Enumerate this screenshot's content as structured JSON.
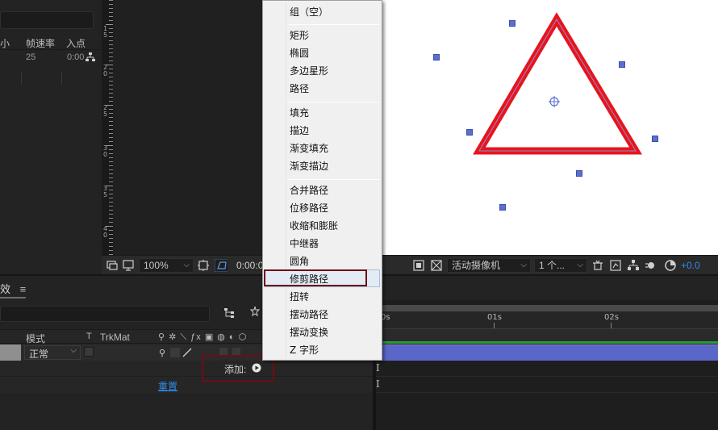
{
  "project_panel": {
    "columns": {
      "size": "小",
      "frame_rate": "帧速率",
      "in_point": "入点"
    },
    "row": {
      "frame_rate": "25",
      "in_point": "0:00"
    }
  },
  "ruler_labels": [
    "1",
    "5",
    "2",
    "0",
    "2",
    "5",
    "3",
    "0",
    "3",
    "5",
    "4",
    "0"
  ],
  "comp_toolbar": {
    "zoom": "100%",
    "timecode": "0:00:0",
    "camera": "活动摄像机",
    "views": "1 个...",
    "exposure": "+0.0"
  },
  "context_menu": {
    "items": [
      "组（空）",
      "矩形",
      "椭圆",
      "多边星形",
      "路径",
      "填充",
      "描边",
      "渐变填充",
      "渐变描边",
      "合并路径",
      "位移路径",
      "收缩和膨胀",
      "中继器",
      "圆角",
      "修剪路径",
      "扭转",
      "摆动路径",
      "摆动变换",
      "Z 字形"
    ],
    "hovered": "修剪路径"
  },
  "timeline": {
    "tab_label": "效",
    "tab_menu": "≡",
    "columns": {
      "mode": "模式",
      "t": "T",
      "trkmat": "TrkMat"
    },
    "layer": {
      "mode": "正常"
    },
    "add_label": "添加:",
    "reset_label": "重置",
    "time_labels": [
      "0s",
      "01s",
      "02s"
    ]
  },
  "colors": {
    "triangle_stroke": "#e8141c",
    "triangle_path": "#8a8fd8",
    "handle": "#5b6fcf",
    "highlight_box": "#6d0e12",
    "layer_bar": "#5a67c8",
    "link_blue": "#2d8ceb"
  },
  "icons": [
    "flowchart-icon",
    "monitor-icon",
    "region-icon",
    "mask-toggle-icon",
    "snapshot-icon",
    "transparency-grid-icon",
    "3d-view-icon",
    "fast-preview-icon",
    "graph-icon",
    "flow-icon",
    "exposure-reset-icon"
  ]
}
